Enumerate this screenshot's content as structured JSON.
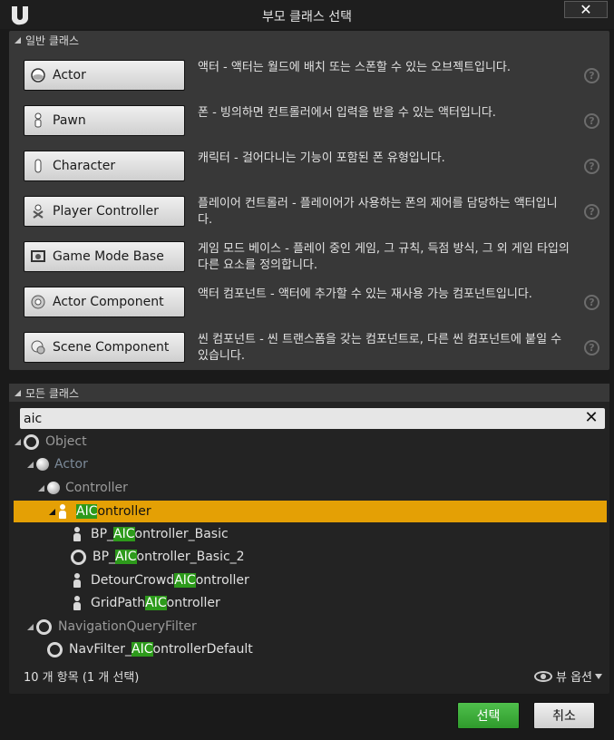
{
  "window": {
    "title": "부모 클래스 선택",
    "close_label": "✕"
  },
  "common": {
    "header": "일반 클래스",
    "items": [
      {
        "label": "Actor",
        "icon": "actor-sphere-icon",
        "desc": "액터 - 액터는 월드에 배치 또는 스폰할 수 있는 오브젝트입니다."
      },
      {
        "label": "Pawn",
        "icon": "pawn-icon",
        "desc": "폰 - 빙의하면 컨트롤러에서 입력을 받을 수 있는 액터입니다."
      },
      {
        "label": "Character",
        "icon": "character-icon",
        "desc": "캐릭터 - 걸어다니는 기능이 포함된 폰 유형입니다."
      },
      {
        "label": "Player Controller",
        "icon": "player-controller-icon",
        "desc": "플레이어 컨트롤러 - 플레이어가 사용하는 폰의 제어를 담당하는 액터입니다."
      },
      {
        "label": "Game Mode Base",
        "icon": "game-mode-icon",
        "desc": "게임 모드 베이스 - 플레이 중인 게임, 그 규칙, 득점 방식, 그 외 게임 타입의 다른 요소를 정의합니다."
      },
      {
        "label": "Actor Component",
        "icon": "actor-component-icon",
        "desc": "액터 컴포넌트 - 액터에 추가할 수 있는 재사용 가능 컴포넌트입니다."
      },
      {
        "label": "Scene Component",
        "icon": "scene-component-icon",
        "desc": "씬 컴포넌트 - 씬 트랜스폼을 갖는 컴포넌트로, 다른 씬 컴포넌트에 붙일 수 있습니다."
      }
    ],
    "help_label": "?"
  },
  "all": {
    "header": "모든 클래스",
    "search_value": "aic",
    "clear_label": "✕",
    "tree": {
      "object": "Object",
      "actor": "Actor",
      "controller": "Controller",
      "aicontroller_hl": "AIC",
      "aicontroller_rest": "ontroller",
      "bp_basic_pre": "BP_",
      "bp_basic_hl": "AIC",
      "bp_basic_post": "ontroller_Basic",
      "bp_basic2_pre": "BP_",
      "bp_basic2_hl": "AIC",
      "bp_basic2_post": "ontroller_Basic_2",
      "detour_pre": "DetourCrowd",
      "detour_hl": "AIC",
      "detour_post": "ontroller",
      "gridpath_pre": "GridPath",
      "gridpath_hl": "AIC",
      "gridpath_post": "ontroller",
      "navquery": "NavigationQueryFilter",
      "navfilter_pre": "NavFilter_",
      "navfilter_hl": "AIC",
      "navfilter_post": "ontrollerDefault"
    },
    "status": "10 개 항목 (1 개 선택)",
    "view_options": "뷰 옵션"
  },
  "footer": {
    "select_label": "선택",
    "cancel_label": "취소"
  }
}
